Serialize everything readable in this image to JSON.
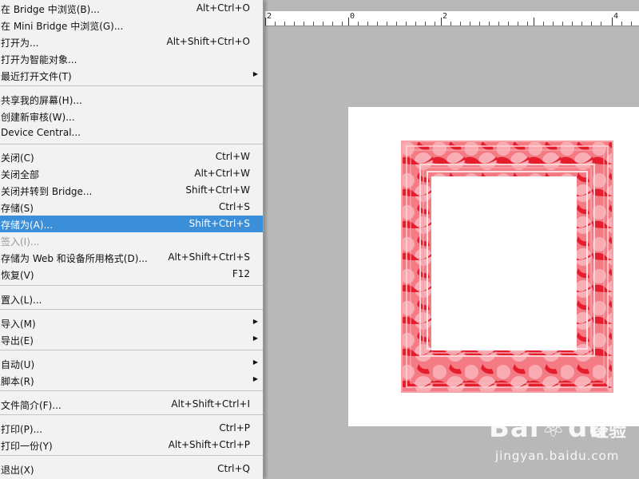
{
  "menu": {
    "items": [
      {
        "label": "在 Bridge 中浏览(B)...",
        "shortcut": "Alt+Ctrl+O"
      },
      {
        "label": "在 Mini Bridge 中浏览(G)...",
        "shortcut": ""
      },
      {
        "label": "打开为...",
        "shortcut": "Alt+Shift+Ctrl+O"
      },
      {
        "label": "打开为智能对象...",
        "shortcut": ""
      },
      {
        "label": "最近打开文件(T)",
        "shortcut": ""
      },
      {
        "label": "共享我的屏幕(H)...",
        "shortcut": ""
      },
      {
        "label": "创建新审核(W)...",
        "shortcut": ""
      },
      {
        "label": "Device Central...",
        "shortcut": ""
      },
      {
        "label": "关闭(C)",
        "shortcut": "Ctrl+W"
      },
      {
        "label": "关闭全部",
        "shortcut": "Alt+Ctrl+W"
      },
      {
        "label": "关闭并转到 Bridge...",
        "shortcut": "Shift+Ctrl+W"
      },
      {
        "label": "存储(S)",
        "shortcut": "Ctrl+S"
      },
      {
        "label": "存储为(A)...",
        "shortcut": "Shift+Ctrl+S"
      },
      {
        "label": "签入(I)...",
        "shortcut": ""
      },
      {
        "label": "存储为 Web 和设备所用格式(D)...",
        "shortcut": "Alt+Shift+Ctrl+S"
      },
      {
        "label": "恢复(V)",
        "shortcut": "F12"
      },
      {
        "label": "置入(L)...",
        "shortcut": ""
      },
      {
        "label": "导入(M)",
        "shortcut": ""
      },
      {
        "label": "导出(E)",
        "shortcut": ""
      },
      {
        "label": "自动(U)",
        "shortcut": ""
      },
      {
        "label": "脚本(R)",
        "shortcut": ""
      },
      {
        "label": "文件简介(F)...",
        "shortcut": "Alt+Shift+Ctrl+I"
      },
      {
        "label": "打印(P)...",
        "shortcut": "Ctrl+P"
      },
      {
        "label": "打印一份(Y)",
        "shortcut": "Alt+Shift+Ctrl+P"
      },
      {
        "label": "退出(X)",
        "shortcut": "Ctrl+Q"
      }
    ],
    "highlighted_color": "#3b8ed8"
  },
  "ruler": {
    "labels": [
      "2",
      "0",
      "2",
      "4"
    ]
  },
  "watermark": {
    "logo": "Bai",
    "logo_tail": "du",
    "brand": "经验",
    "url": "jingyan.baidu.com"
  },
  "colors": {
    "frame": "#e8202c",
    "workspace": "#b8b8b8"
  }
}
